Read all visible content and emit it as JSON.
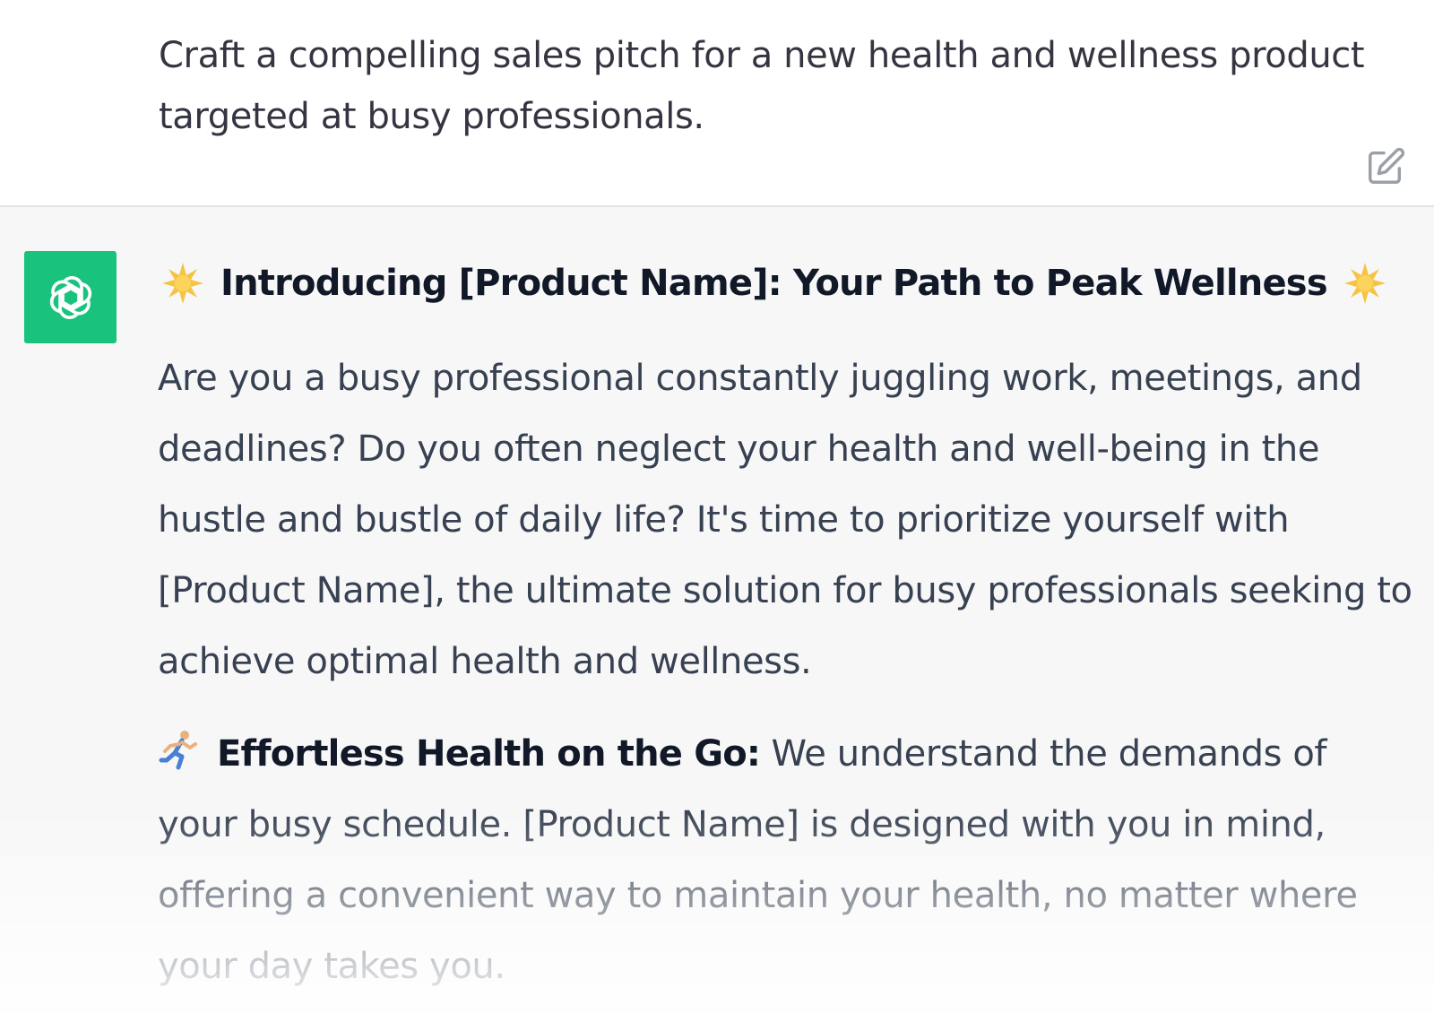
{
  "user_message": {
    "text": "Craft a compelling sales pitch for a new health and wellness product targeted at busy professionals.",
    "edit_icon": "edit-pencil-icon"
  },
  "assistant_message": {
    "avatar_icon": "openai-logo-icon",
    "heading_emoji": "sparkle-sun-icon",
    "heading": "Introducing [Product Name]: Your Path to Peak Wellness",
    "intro_paragraph": "Are you a busy professional constantly juggling work, meetings, and deadlines? Do you often neglect your health and well-being in the hustle and bustle of daily life? It's time to prioritize yourself with [Product Name], the ultimate solution for busy professionals seeking to achieve optimal health and wellness.",
    "feature": {
      "icon": "running-person-icon",
      "title": "Effortless Health on the Go:",
      "text": " We understand the demands of your busy schedule. [Product Name] is designed with you in mind, offering a convenient way to maintain your health, no matter where your day takes you."
    }
  },
  "colors": {
    "avatar_bg": "#19c37d",
    "assistant_bg": "#f7f7f8",
    "text": "#374151",
    "heading": "#111827"
  }
}
